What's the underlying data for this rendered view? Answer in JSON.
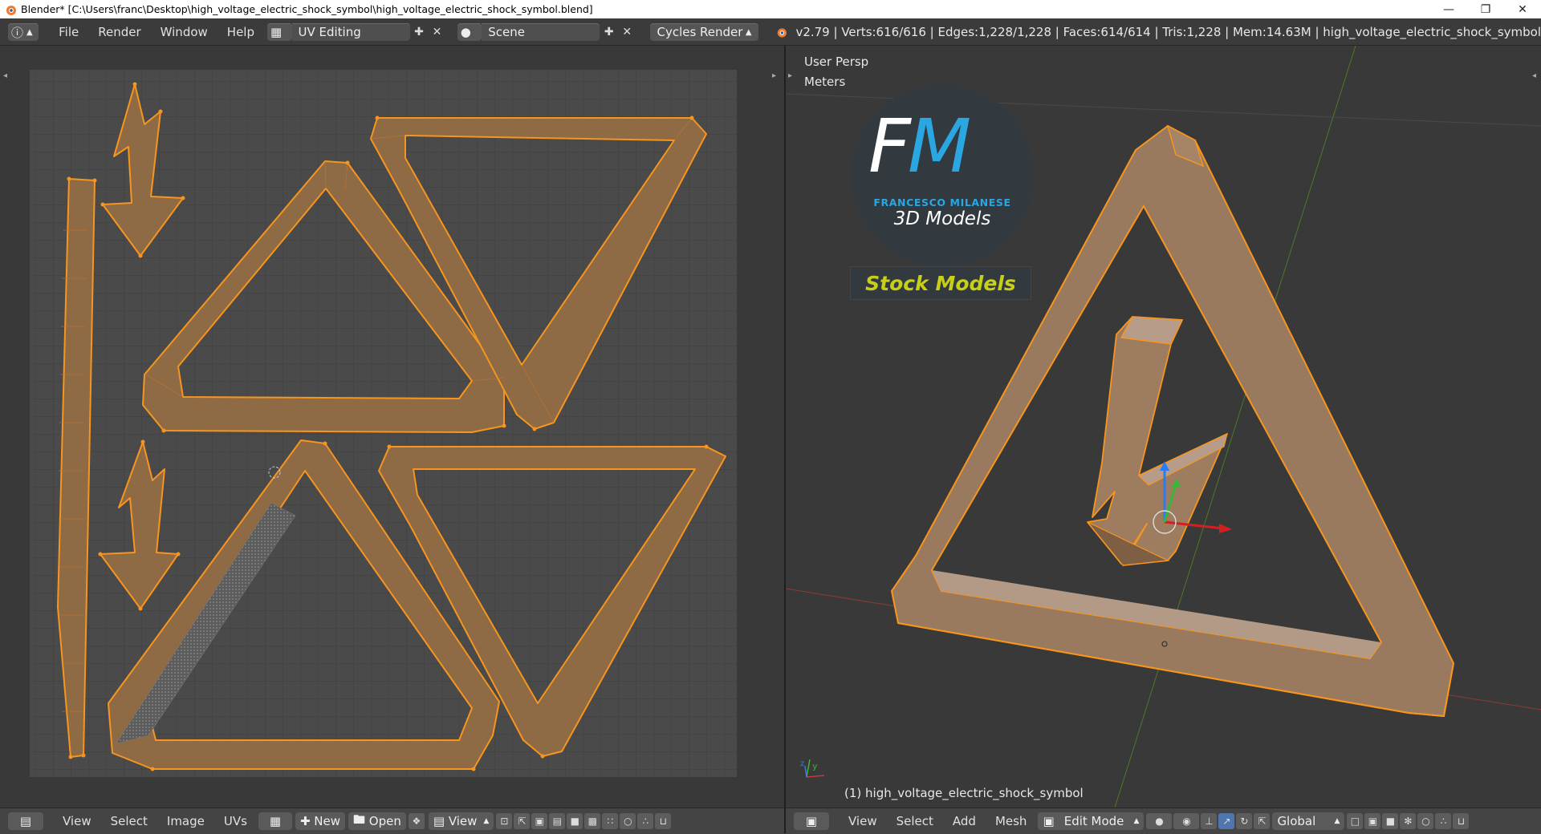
{
  "window": {
    "title": "Blender* [C:\\Users\\franc\\Desktop\\high_voltage_electric_shock_symbol\\high_voltage_electric_shock_symbol.blend]",
    "controls": [
      "minimize-icon",
      "restore-icon",
      "close-icon"
    ]
  },
  "infobar": {
    "menus": [
      "File",
      "Render",
      "Window",
      "Help"
    ],
    "screen_layout": "UV Editing",
    "scene": "Scene",
    "engine": "Cycles Render",
    "stats": "v2.79 | Verts:616/616 | Edges:1,228/1,228 | Faces:614/614 | Tris:1,228 | Mem:14.63M | high_voltage_electric_shock_symbol"
  },
  "viewport": {
    "view_name": "User Persp",
    "units": "Meters",
    "object_label": "(1) high_voltage_electric_shock_symbol",
    "watermark": {
      "initials_1": "F",
      "initials_2": "M",
      "author": "FRANCESCO MILANESE",
      "subtitle": "3D Models",
      "banner": "Stock Models"
    }
  },
  "uv_footer": {
    "menus": [
      "View",
      "Select",
      "Image",
      "UVs"
    ],
    "new_label": "New",
    "open_label": "Open",
    "view_label": "View"
  },
  "viewport_footer": {
    "menus": [
      "View",
      "Select",
      "Add",
      "Mesh"
    ],
    "mode": "Edit Mode",
    "orientation": "Global"
  },
  "colors": {
    "accent": "#f7951e",
    "face_fill": "#8e6a45",
    "grid_bg": "#474747",
    "watermark_blue": "#2aa7e0",
    "banner_yellow": "#c8cf17"
  }
}
